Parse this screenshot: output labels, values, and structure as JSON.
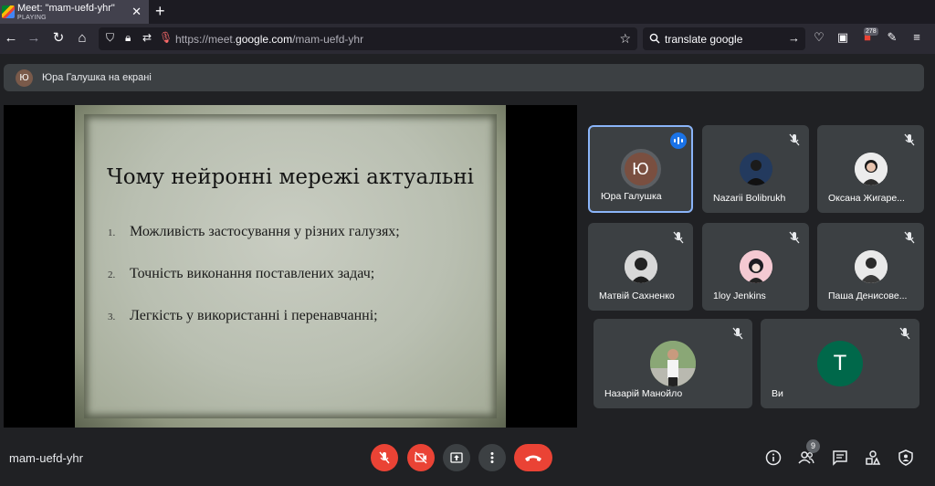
{
  "browser": {
    "tab_title": "Meet: \"mam-uefd-yhr\"",
    "tab_status": "PLAYING",
    "url_prefix": "https://meet.",
    "url_domain": "google.com",
    "url_path": "/mam-uefd-yhr",
    "search_text": "translate google",
    "ext_badge": "278"
  },
  "meet": {
    "presenter_initial": "Ю",
    "presenter_text": "Юра Галушка на екрані",
    "meeting_code": "mam-uefd-yhr",
    "people_count": "9"
  },
  "slide": {
    "title": "Чому нейронні мережі актуальні",
    "items": [
      {
        "num": "1.",
        "text": "Можливість застосування у різних галузях;"
      },
      {
        "num": "2.",
        "text": "Точність виконання поставлених задач;"
      },
      {
        "num": "3.",
        "text": "Легкість у використанні і перенавчанні;"
      }
    ]
  },
  "participants": [
    {
      "name": "Юра Галушка",
      "initial": "Ю",
      "speaking": true
    },
    {
      "name": "Nazarii Bolibrukh",
      "muted": true
    },
    {
      "name": "Оксана Жигаре...",
      "muted": true
    },
    {
      "name": "Матвій Сахненко",
      "muted": true
    },
    {
      "name": "1loy Jenkins",
      "muted": true
    },
    {
      "name": "Паша Денисове...",
      "muted": true
    },
    {
      "name": "Назарій Манойло",
      "muted": true
    },
    {
      "name": "Ви",
      "initial": "T",
      "muted": true
    }
  ],
  "colors": {
    "accent": "#8ab4f8",
    "danger": "#ea4335",
    "you_avatar": "#00684a"
  }
}
